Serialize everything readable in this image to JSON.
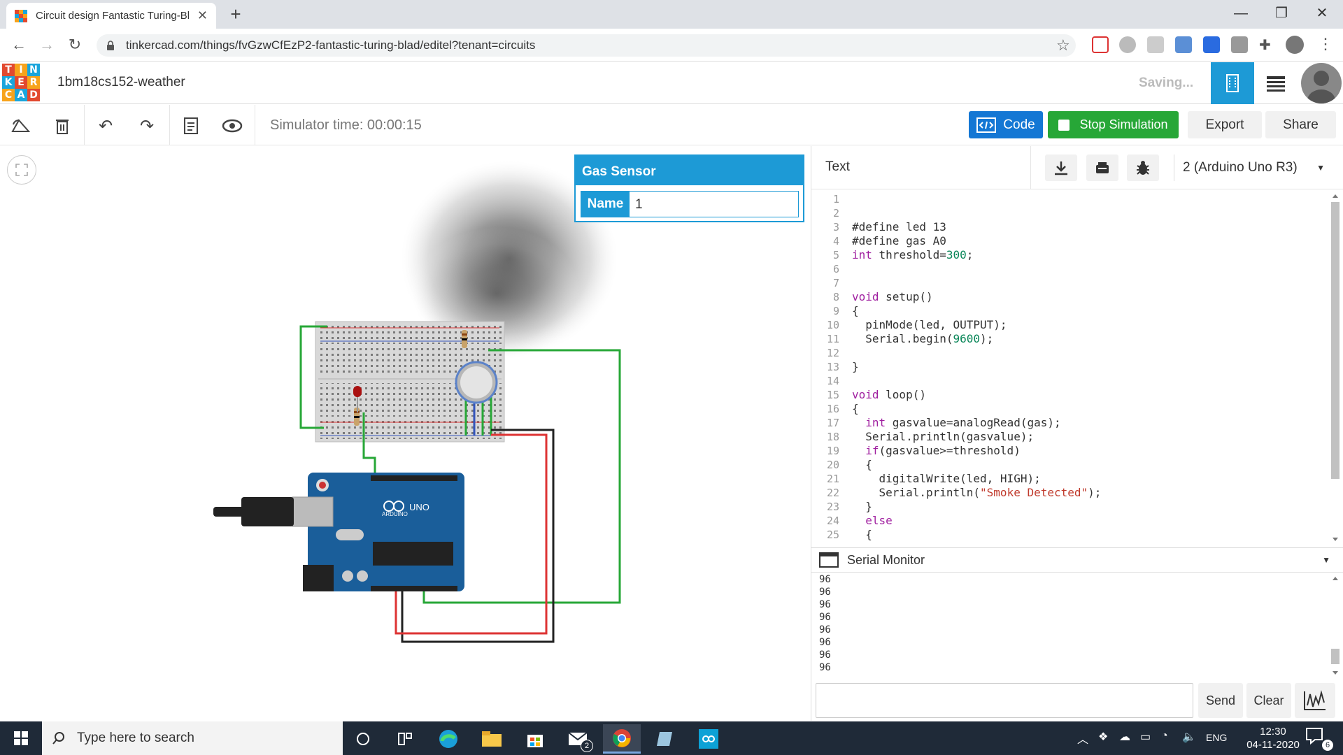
{
  "browser": {
    "tab_title": "Circuit design Fantastic Turing-Bl",
    "url": "tinkercad.com/things/fvGzwCfEzP2-fantastic-turing-blad/editel?tenant=circuits"
  },
  "app": {
    "logo_letters": [
      "T",
      "I",
      "N",
      "K",
      "E",
      "R",
      "C",
      "A",
      "D"
    ],
    "logo_colors": [
      "#e2492f",
      "#f7a31c",
      "#1aa5dc",
      "#1aa5dc",
      "#e2492f",
      "#f7a31c",
      "#f7a31c",
      "#1aa5dc",
      "#e2492f"
    ],
    "project_name": "1bm18cs152-weather",
    "save_status": "Saving..."
  },
  "toolbar": {
    "sim_time": "Simulator time: 00:00:15",
    "code_label": "Code",
    "stop_label": "Stop Simulation",
    "export_label": "Export",
    "share_label": "Share"
  },
  "inspector": {
    "title": "Gas Sensor",
    "name_label": "Name",
    "name_value": "1"
  },
  "code_panel": {
    "mode": "Text",
    "board": "2 (Arduino Uno R3)",
    "lines": [
      "",
      "",
      "#define led 13",
      "#define gas A0",
      "int threshold=300;",
      "",
      "",
      "void setup()",
      "{",
      "  pinMode(led, OUTPUT);",
      "  Serial.begin(9600);",
      "",
      "}",
      "",
      "void loop()",
      "{",
      "  int gasvalue=analogRead(gas);",
      "  Serial.println(gasvalue);",
      "  if(gasvalue>=threshold)",
      "  {",
      "    digitalWrite(led, HIGH);",
      "    Serial.println(\"Smoke Detected\");",
      "  }",
      "  else",
      "  {"
    ]
  },
  "serial_monitor": {
    "title": "Serial Monitor",
    "output": [
      "96",
      "96",
      "96",
      "96",
      "96",
      "96",
      "96",
      "96"
    ],
    "send_label": "Send",
    "clear_label": "Clear"
  },
  "taskbar": {
    "search_placeholder": "Type here to search",
    "mail_badge": "2",
    "lang": "ENG",
    "time": "12:30",
    "date": "04-11-2020",
    "notif_count": "6"
  },
  "colors": {
    "tinkercad_blue": "#1d9ad6",
    "code_blue": "#1477d4",
    "stop_green": "#27a737",
    "keyword": "#a020a0",
    "number": "#098658",
    "string": "#c0392b"
  }
}
